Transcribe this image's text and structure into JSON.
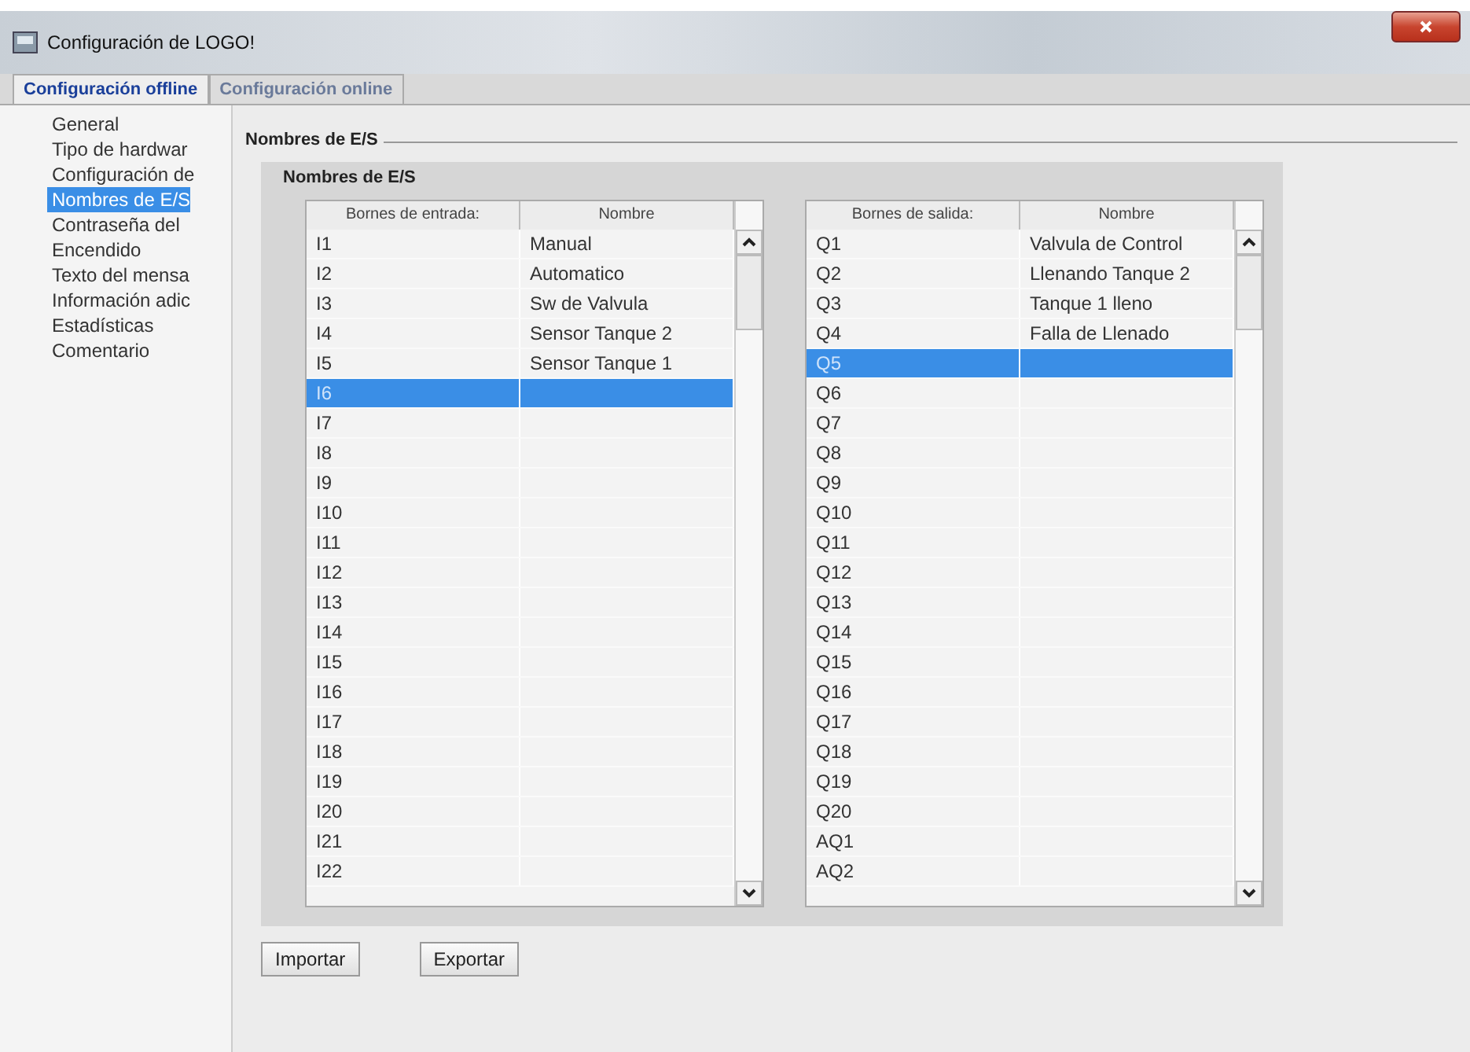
{
  "window": {
    "title": "Configuración de LOGO!"
  },
  "tabs": [
    {
      "label": "Configuración offline",
      "selected": true
    },
    {
      "label": "Configuración online",
      "selected": false
    }
  ],
  "sidebar": {
    "items": [
      {
        "label": "General",
        "selected": false
      },
      {
        "label": "Tipo de hardwar",
        "selected": false
      },
      {
        "label": "Configuración de",
        "selected": false
      },
      {
        "label": "Nombres de E/S",
        "selected": true
      },
      {
        "label": "Contraseña del",
        "selected": false
      },
      {
        "label": "Encendido",
        "selected": false
      },
      {
        "label": "Texto del mensa",
        "selected": false
      },
      {
        "label": "Información adic",
        "selected": false
      },
      {
        "label": "Estadísticas",
        "selected": false
      },
      {
        "label": "Comentario",
        "selected": false
      }
    ]
  },
  "section_title": "Nombres de E/S",
  "group_title": "Nombres de E/S",
  "tables": [
    {
      "columns": [
        "Bornes de entrada:",
        "Nombre"
      ],
      "rows": [
        {
          "terminal": "I1",
          "name": "Manual",
          "selected": false
        },
        {
          "terminal": "I2",
          "name": "Automatico",
          "selected": false
        },
        {
          "terminal": "I3",
          "name": "Sw de Valvula",
          "selected": false
        },
        {
          "terminal": "I4",
          "name": "Sensor Tanque 2",
          "selected": false
        },
        {
          "terminal": "I5",
          "name": "Sensor Tanque 1",
          "selected": false
        },
        {
          "terminal": "I6",
          "selected": true
        },
        {
          "terminal": "I7",
          "selected": false
        },
        {
          "terminal": "I8",
          "selected": false
        },
        {
          "terminal": "I9",
          "selected": false
        },
        {
          "terminal": "I10",
          "selected": false
        },
        {
          "terminal": "I11",
          "selected": false
        },
        {
          "terminal": "I12",
          "selected": false
        },
        {
          "terminal": "I13",
          "selected": false
        },
        {
          "terminal": "I14",
          "selected": false
        },
        {
          "terminal": "I15",
          "selected": false
        },
        {
          "terminal": "I16",
          "selected": false
        },
        {
          "terminal": "I17",
          "selected": false
        },
        {
          "terminal": "I18",
          "selected": false
        },
        {
          "terminal": "I19",
          "selected": false
        },
        {
          "terminal": "I20",
          "selected": false
        },
        {
          "terminal": "I21",
          "selected": false
        },
        {
          "terminal": "I22",
          "selected": false
        }
      ]
    },
    {
      "columns": [
        "Bornes de salida:",
        "Nombre"
      ],
      "rows": [
        {
          "terminal": "Q1",
          "name": "Valvula de Control",
          "selected": false
        },
        {
          "terminal": "Q2",
          "name": "Llenando Tanque 2",
          "selected": false
        },
        {
          "terminal": "Q3",
          "name": "Tanque 1 lleno",
          "selected": false
        },
        {
          "terminal": "Q4",
          "name": "Falla de Llenado",
          "selected": false
        },
        {
          "terminal": "Q5",
          "selected": true
        },
        {
          "terminal": "Q6",
          "selected": false
        },
        {
          "terminal": "Q7",
          "selected": false
        },
        {
          "terminal": "Q8",
          "selected": false
        },
        {
          "terminal": "Q9",
          "selected": false
        },
        {
          "terminal": "Q10",
          "selected": false
        },
        {
          "terminal": "Q11",
          "selected": false
        },
        {
          "terminal": "Q12",
          "selected": false
        },
        {
          "terminal": "Q13",
          "selected": false
        },
        {
          "terminal": "Q14",
          "selected": false
        },
        {
          "terminal": "Q15",
          "selected": false
        },
        {
          "terminal": "Q16",
          "selected": false
        },
        {
          "terminal": "Q17",
          "selected": false
        },
        {
          "terminal": "Q18",
          "selected": false
        },
        {
          "terminal": "Q19",
          "selected": false
        },
        {
          "terminal": "Q20",
          "selected": false
        },
        {
          "terminal": "AQ1",
          "selected": false
        },
        {
          "terminal": "AQ2",
          "selected": false
        }
      ]
    }
  ],
  "buttons": [
    "Importar",
    "Exportar"
  ]
}
